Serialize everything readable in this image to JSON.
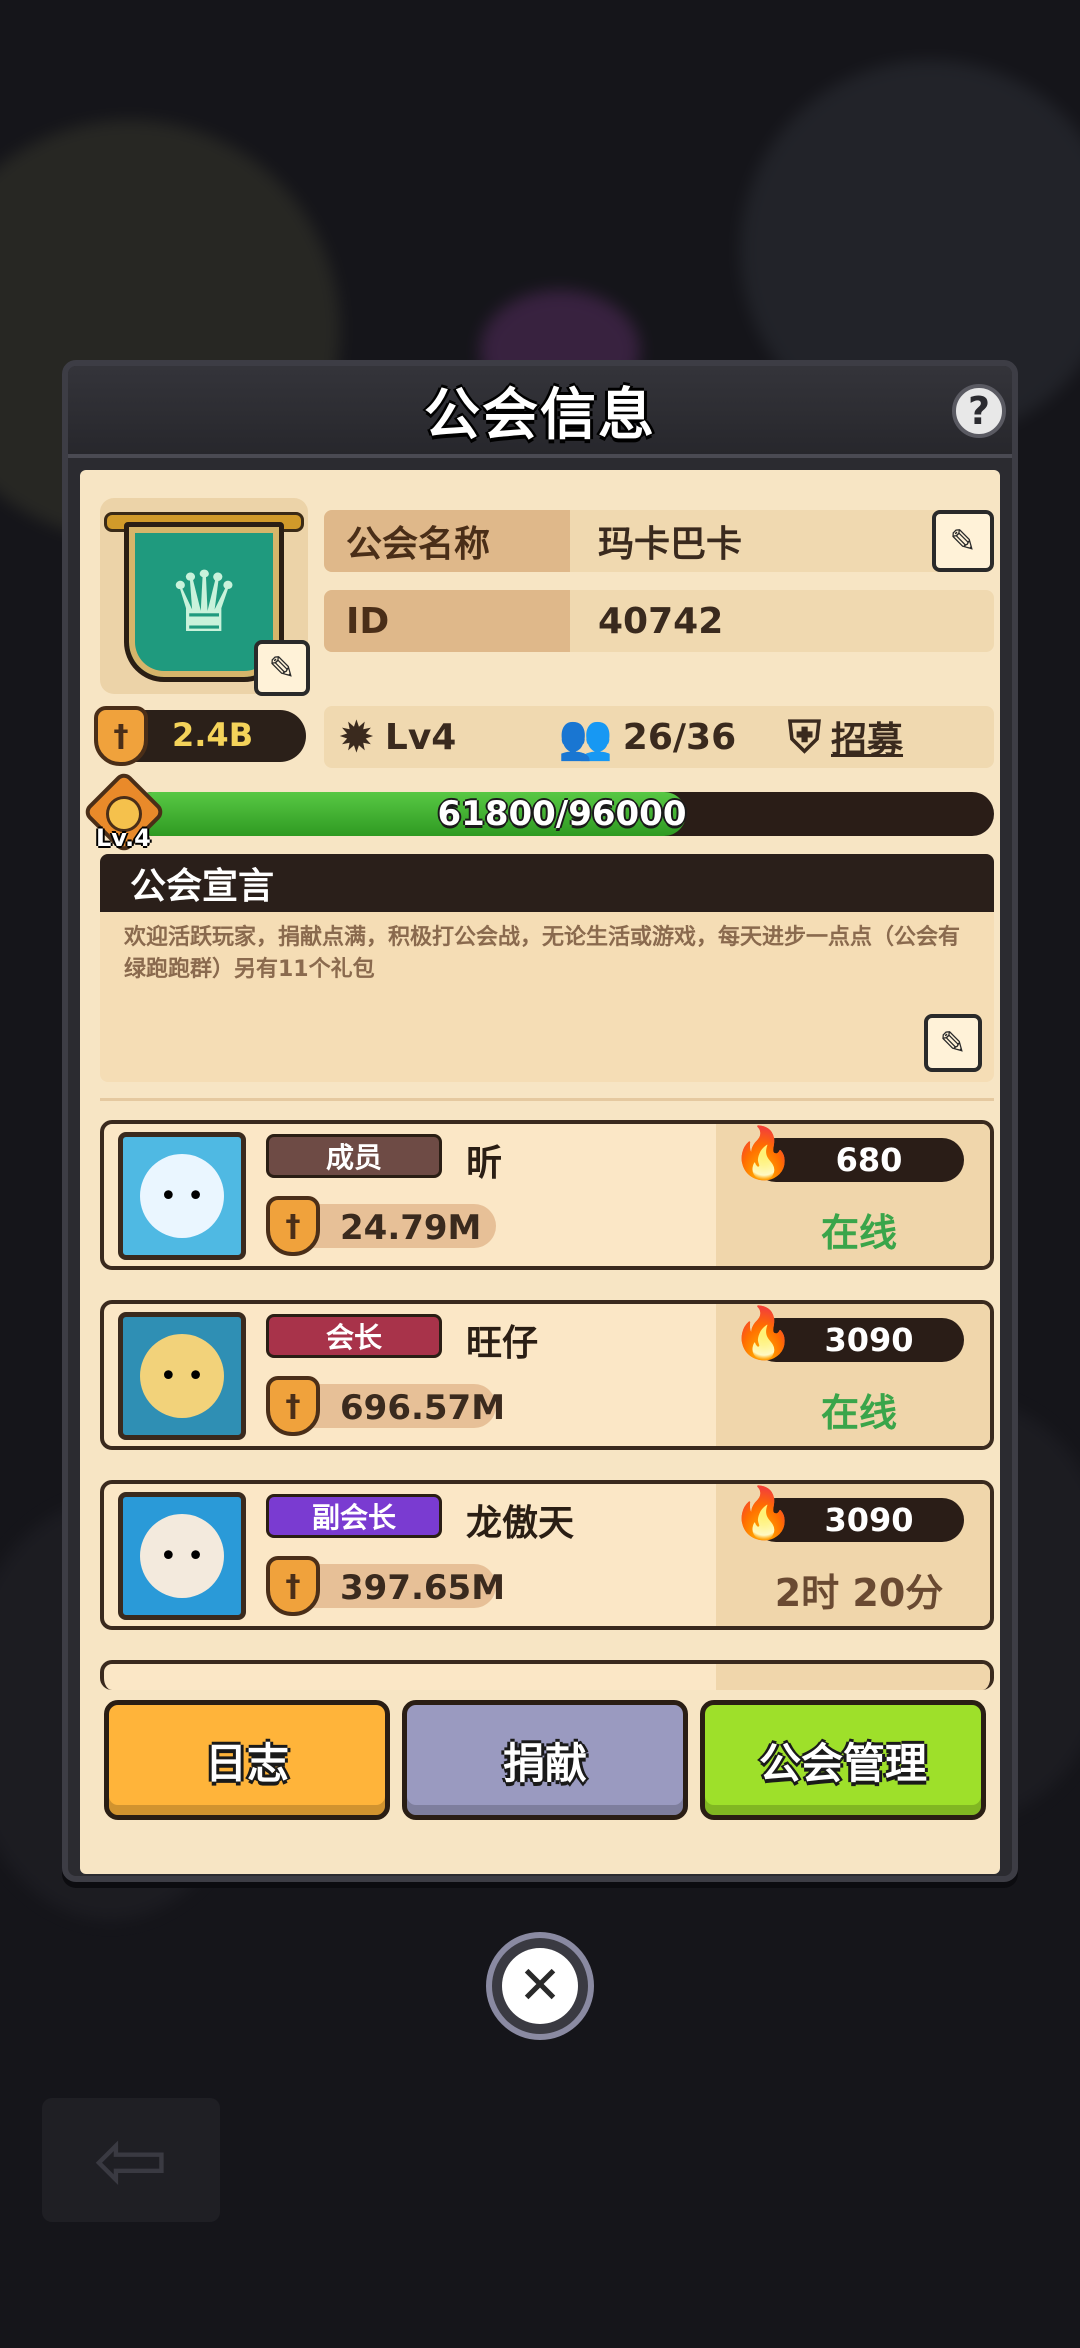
{
  "panel": {
    "title": "公会信息",
    "help_icon": "question-icon"
  },
  "guild": {
    "name_label": "公会名称",
    "name_value": "玛卡巴卡",
    "id_label": "ID",
    "id_value": "40742",
    "power": "2.4B",
    "level": "Lv4",
    "members": "26/36",
    "recruit_label": "招募",
    "exp_text": "61800/96000",
    "exp_progress": 0.64375,
    "level_badge": "Lv.4"
  },
  "declaration": {
    "title": "公会宣言",
    "text": "欢迎活跃玩家，捐献点满，积极打公会战，无论生活或游戏，每天进步一点点（公会有绿跑跑群）另有11个礼包"
  },
  "members": [
    {
      "role": "成员",
      "role_color": "#6e4b45",
      "name": "昕",
      "power": "24.79M",
      "activity": "680",
      "status": "在线",
      "status_color": "#3aa54a",
      "avatar_bg": "#4fb9e3",
      "avatar_face": "#eaf6ff"
    },
    {
      "role": "会长",
      "role_color": "#a8334a",
      "name": "旺仔",
      "power": "696.57M",
      "activity": "3090",
      "status": "在线",
      "status_color": "#3aa54a",
      "avatar_bg": "#2f8fb4",
      "avatar_face": "#f2d27a"
    },
    {
      "role": "副会长",
      "role_color": "#7a3bd1",
      "name": "龙傲天",
      "power": "397.65M",
      "activity": "3090",
      "status": "2时 20分",
      "status_color": "#6a4a32",
      "avatar_bg": "#2a9ad8",
      "avatar_face": "#f3eadd"
    }
  ],
  "buttons": {
    "log": "日志",
    "donate": "捐献",
    "manage": "公会管理",
    "log_color": "#ffb43a",
    "donate_color": "#9a9ac0",
    "manage_color": "#9ee02a"
  },
  "icons": {
    "crown": "crown-icon",
    "edit": "edit-icon",
    "sword": "sword-icon",
    "gear": "gear-icon",
    "people": "people-icon",
    "shield": "shield-icon",
    "fire": "fire-icon",
    "close": "close-icon",
    "back": "back-arrow-icon"
  }
}
